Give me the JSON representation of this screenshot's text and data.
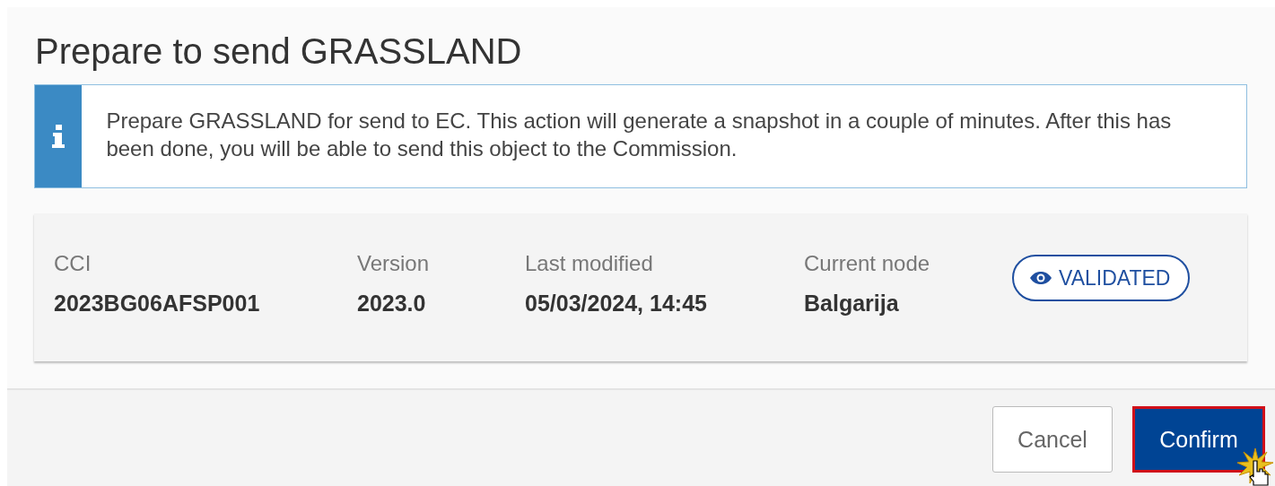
{
  "dialog": {
    "title": "Prepare to send GRASSLAND",
    "info": {
      "text": "Prepare GRASSLAND for send to EC. This action will generate a snapshot in a couple of minutes. After this has been done, you will be able to send this object to the Commission."
    },
    "fields": [
      {
        "label": "CCI",
        "value": "2023BG06AFSP001"
      },
      {
        "label": "Version",
        "value": "2023.0"
      },
      {
        "label": "Last modified",
        "value": "05/03/2024, 14:45"
      },
      {
        "label": "Current node",
        "value": "Balgarija"
      }
    ],
    "status_badge": "VALIDATED",
    "buttons": [
      {
        "label": "Cancel",
        "kind": "secondary",
        "focused": false
      },
      {
        "label": "Confirm",
        "kind": "primary",
        "focused": true
      }
    ]
  }
}
